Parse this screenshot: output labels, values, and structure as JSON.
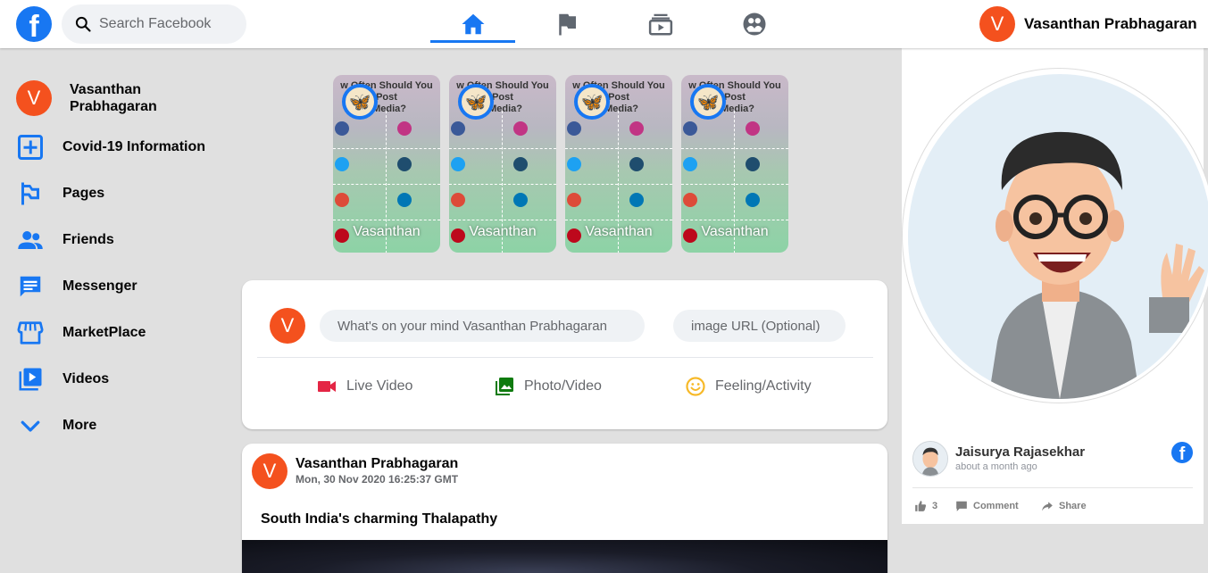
{
  "header": {
    "search_placeholder": "Search Facebook",
    "user_initial": "V",
    "user_name": "Vasanthan Prabhagaran",
    "nav_tabs": [
      {
        "icon": "home-icon",
        "active": true
      },
      {
        "icon": "flag-icon",
        "active": false
      },
      {
        "icon": "watch-icon",
        "active": false
      },
      {
        "icon": "groups-icon",
        "active": false
      }
    ]
  },
  "sidebar": {
    "profile": {
      "initial": "V",
      "name": "Vasanthan\nPrabhagaran"
    },
    "items": [
      {
        "label": "Covid-19 Information",
        "icon": "plus-square-icon"
      },
      {
        "label": "Pages",
        "icon": "pages-flag-icon"
      },
      {
        "label": "Friends",
        "icon": "friends-icon"
      },
      {
        "label": "Messenger",
        "icon": "messenger-icon"
      },
      {
        "label": "MarketPlace",
        "icon": "storefront-icon"
      },
      {
        "label": "Videos",
        "icon": "video-library-icon"
      },
      {
        "label": "More",
        "icon": "chevron-down-icon"
      }
    ]
  },
  "stories": [
    {
      "name": "Vasanthan",
      "headline": "w Often Should You Post\nl Media?"
    },
    {
      "name": "Vasanthan",
      "headline": "w Often Should You Post\nl Media?"
    },
    {
      "name": "Vasanthan",
      "headline": "w Often Should You Post\nl Media?"
    },
    {
      "name": "Vasanthan",
      "headline": "w Often Should You Post\nl Media?"
    }
  ],
  "composer": {
    "initial": "V",
    "post_placeholder": "What's on your mind Vasanthan Prabhagaran",
    "image_placeholder": "image URL (Optional)",
    "actions": [
      {
        "label": "Live Video",
        "icon": "videocam-icon",
        "color": "#e42645"
      },
      {
        "label": "Photo/Video",
        "icon": "photo-library-icon",
        "color": "#0f7b0f"
      },
      {
        "label": "Feeling/Activity",
        "icon": "smiley-icon",
        "color": "#f7b928"
      }
    ]
  },
  "post": {
    "initial": "V",
    "author": "Vasanthan Prabhagaran",
    "timestamp": "Mon, 30 Nov 2020 16:25:37 GMT",
    "caption": "South India's charming Thalapathy"
  },
  "right_card": {
    "commenter_name": "Jaisurya Rajasekhar",
    "commenter_time": "about a month ago",
    "likes": "3",
    "comment_label": "Comment",
    "share_label": "Share"
  },
  "colors": {
    "brand": "#1877f2",
    "avatar": "#f4511e",
    "background": "#e0e0e0"
  }
}
